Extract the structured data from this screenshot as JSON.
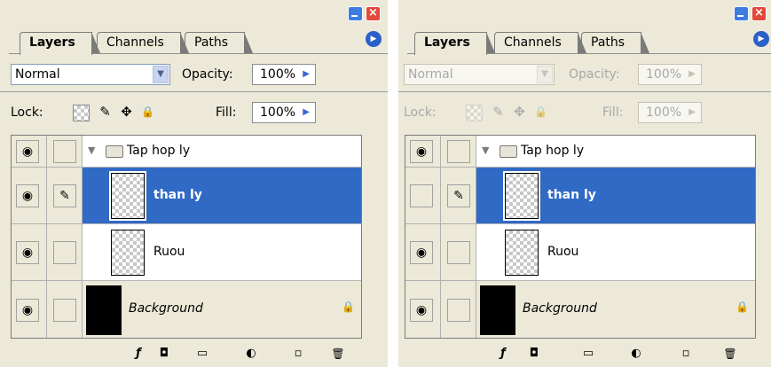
{
  "tabs": {
    "layers": "Layers",
    "channels": "Channels",
    "paths": "Paths"
  },
  "blend_mode": "Normal",
  "opacity": {
    "label": "Opacity:",
    "value": "100%"
  },
  "lock": {
    "label": "Lock:"
  },
  "fill": {
    "label": "Fill:",
    "value": "100%"
  },
  "layers": {
    "group": "Tap hop ly",
    "selected": "than ly",
    "normal": "Ruou",
    "background": "Background"
  },
  "icons": {
    "close": "×",
    "flyout": "▶",
    "dropdown": "▼",
    "spin": "▶",
    "eye": "◉",
    "brush": "✎",
    "move": "✥",
    "padlock": "🔒",
    "expander": "▼",
    "folder": "▭",
    "scroll_up": "▲",
    "scroll_down": "▼",
    "grip": "≡",
    "styles": "ƒ",
    "mask": "◘",
    "group": "▭",
    "adjust": "◐",
    "new": "▫",
    "trash": "🗑"
  },
  "colors": {
    "panel_bg": "#ece9d8",
    "selection": "#316ac5",
    "close_red": "#e2483b",
    "xp_blue": "#3d7ce0",
    "inactive_text": "#a8a8a8"
  }
}
